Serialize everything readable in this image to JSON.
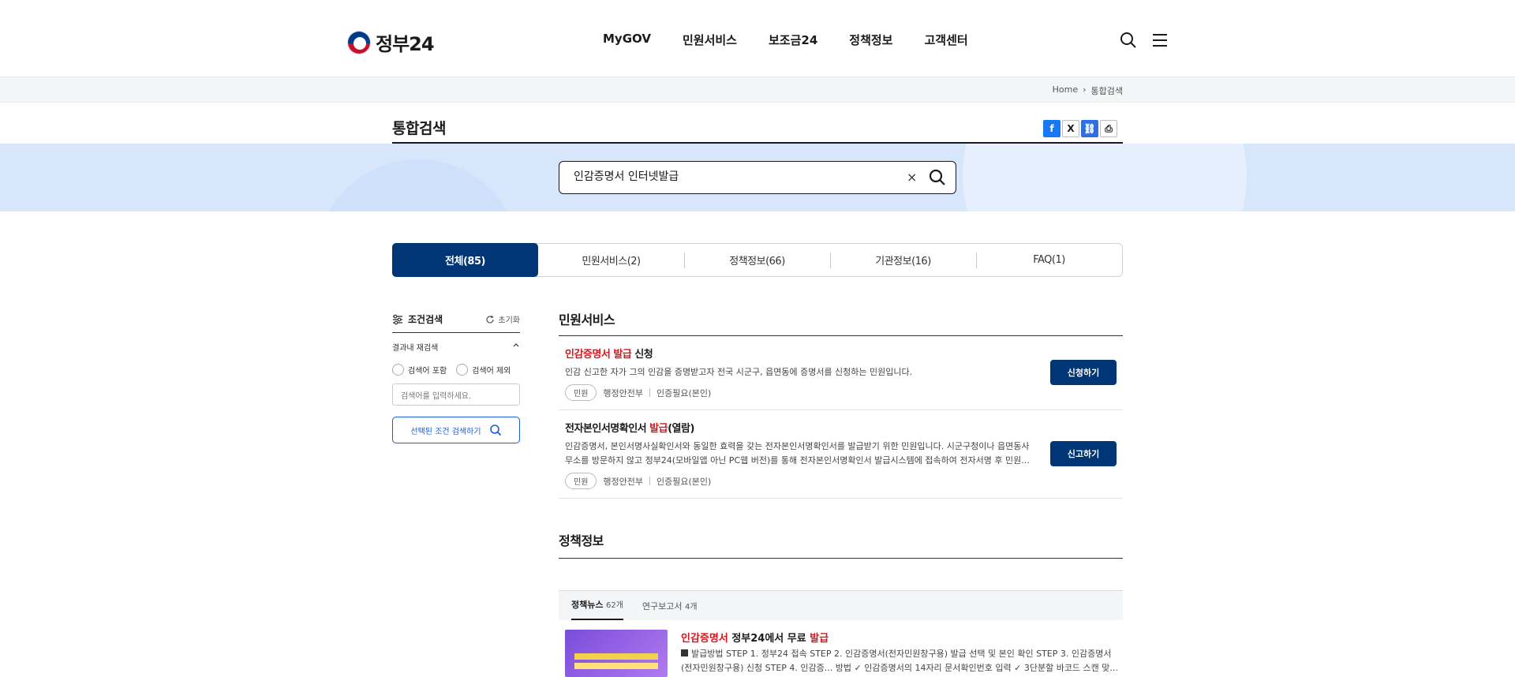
{
  "header": {
    "logo_text": "정부24",
    "nav": [
      "MyGOV",
      "민원서비스",
      "보조금24",
      "정책정보",
      "고객센터"
    ]
  },
  "breadcrumb": {
    "home": "Home",
    "sep": "›",
    "current": "통합검색"
  },
  "page": {
    "title": "통합검색"
  },
  "share": {
    "facebook": "f",
    "x": "X",
    "link": "⛓",
    "print": "⎙"
  },
  "search": {
    "value": "인감증명서 인터넷발급",
    "clear": "×"
  },
  "tabs": [
    "전체(85)",
    "민원서비스(2)",
    "정책정보(66)",
    "기관정보(16)",
    "FAQ(1)"
  ],
  "filter": {
    "title": "조건검색",
    "reset": "초기화",
    "within": "결과내 재검색",
    "include": "검색어 포함",
    "exclude": "검색어 제외",
    "input_placeholder": "검색어를 입력하세요.",
    "submit": "선택된 조건 검색하기"
  },
  "minwon": {
    "title": "민원서비스",
    "items": [
      {
        "title_hl": "인감증명서 발급",
        "title_rest": " 신청",
        "desc": "인감 신고한 자가 그의 인감을 증명받고자 전국 시군구, 읍면동에 증명서를 신청하는 민원입니다.",
        "tag": "민원",
        "org": "행정안전부",
        "auth": "인증필요(본인)",
        "button": "신청하기"
      },
      {
        "title_pre": "전자본인서명확인서 ",
        "title_hl": "발급",
        "title_rest": "(열람)",
        "desc": "인감증명서, 본인서명사실확인서와 동일한 효력을 갖는 전자본인서명확인서를 발급받기 위한 민원입니다. 시군구청이나 읍면동사무소를 방문하지 않고 정부24(모바일앱 아닌 PC웹 버전)를 통해 전자본인서명확인서 발급시스템에 접속하여 전자서명 후 민원...",
        "tag": "민원",
        "org": "행정안전부",
        "auth": "인증필요(본인)",
        "button": "신고하기"
      }
    ]
  },
  "policy": {
    "title": "정책정보",
    "tabs": [
      {
        "label": "정책뉴스",
        "count": "62개"
      },
      {
        "label": "연구보고서",
        "count": "4개"
      }
    ],
    "news": {
      "title_hl1": "인감증명서",
      "title_mid": " 정부24에서 무료 ",
      "title_hl2": "발급",
      "desc": "발급방법 STEP 1. 정부24 접속 STEP 2. 인감증명서(전자민원창구용) 발급 선택 및 본인 확인 STEP 3. 인감증명서(전자민원창구용) 신청 STEP 4. 인감증... 방법 ✓ 인감증명서의 14자리 문서확인번호 입력 ✓ 3단분할 바코드 스캔 맞..."
    }
  },
  "colors": {
    "primary": "#003675",
    "highlight": "#d6171f",
    "band": "#d7e6fb"
  }
}
